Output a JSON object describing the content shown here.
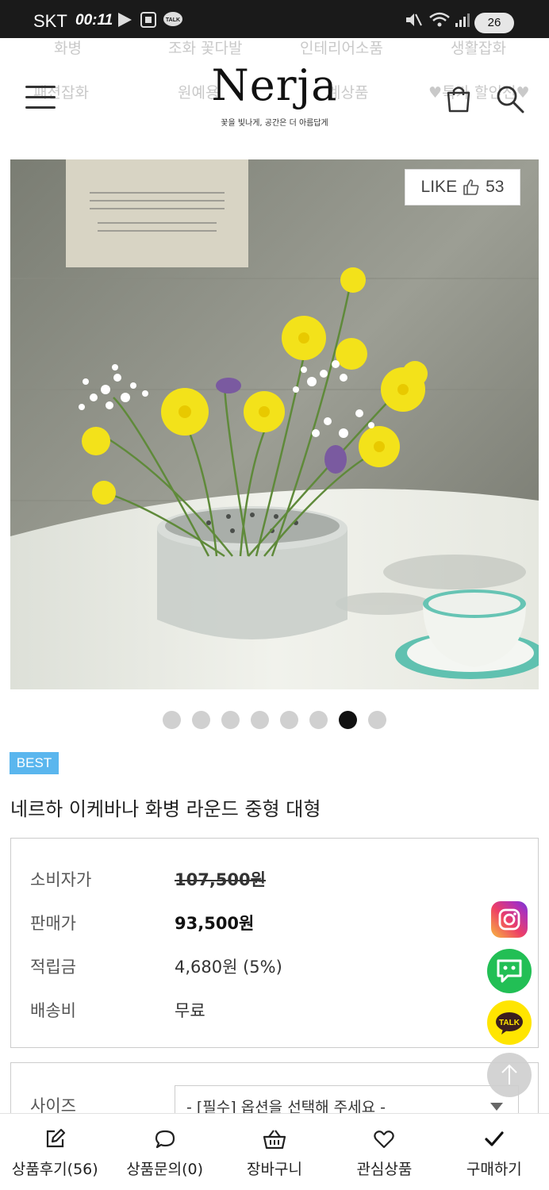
{
  "status_bar": {
    "carrier": "SKT",
    "time": "00:11",
    "battery": "26"
  },
  "header": {
    "logo": "Nerja",
    "tagline": "꽃을 빛나게, 공간은 더 아름답게",
    "ghost_menu": [
      "화병",
      "조화 꽃다발",
      "인테리어소품",
      "생활잡화",
      "패션잡화",
      "원예용",
      "계상품",
      "♥특가 할인전♥"
    ]
  },
  "product": {
    "like_label": "LIKE",
    "like_count": "53",
    "image_count": 8,
    "active_image_index": 6,
    "badge": "BEST",
    "name": "네르하 이케바나 화병 라운드 중형 대형"
  },
  "price": {
    "rows": [
      {
        "label": "소비자가",
        "value": "107,500원"
      },
      {
        "label": "판매가",
        "value": "93,500원"
      },
      {
        "label": "적립금",
        "value": "4,680원 (5%)"
      },
      {
        "label": "배송비",
        "value": "무료"
      }
    ]
  },
  "floating": {
    "kakao_label": "TALK"
  },
  "option": {
    "label": "사이즈",
    "placeholder": "- [필수] 옵션을 선택해 주세요 -"
  },
  "bottom_nav": [
    {
      "label": "상품후기(56)",
      "icon": "edit-icon"
    },
    {
      "label": "상품문의(0)",
      "icon": "speech-bubble-icon"
    },
    {
      "label": "장바구니",
      "icon": "basket-icon"
    },
    {
      "label": "관심상품",
      "icon": "heart-icon"
    },
    {
      "label": "구매하기",
      "icon": "check-icon"
    }
  ],
  "colors": {
    "best_badge": "#5ab6ee",
    "status_bar": "#1a1a1a",
    "instagram": "#ee4065",
    "chat": "#22bf55",
    "kakao": "#ffe500"
  }
}
